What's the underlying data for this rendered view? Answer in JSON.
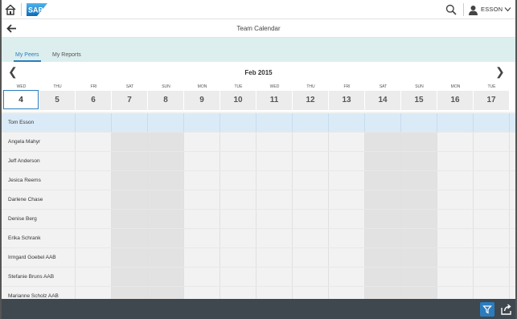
{
  "shell": {
    "brand": "SAP",
    "user_name": "ESSON"
  },
  "page": {
    "title": "Team Calendar"
  },
  "tabs": [
    {
      "label": "My Peers",
      "selected": true
    },
    {
      "label": "My Reports",
      "selected": false
    }
  ],
  "calendar": {
    "month_label": "Feb 2015",
    "days": [
      {
        "dow": "WED",
        "num": "4",
        "weekend": false,
        "today": true
      },
      {
        "dow": "THU",
        "num": "5",
        "weekend": false
      },
      {
        "dow": "FRI",
        "num": "6",
        "weekend": false
      },
      {
        "dow": "SAT",
        "num": "7",
        "weekend": true
      },
      {
        "dow": "SUN",
        "num": "8",
        "weekend": true
      },
      {
        "dow": "MON",
        "num": "9",
        "weekend": false
      },
      {
        "dow": "TUE",
        "num": "10",
        "weekend": false
      },
      {
        "dow": "WED",
        "num": "11",
        "weekend": false
      },
      {
        "dow": "THU",
        "num": "12",
        "weekend": false
      },
      {
        "dow": "FRI",
        "num": "13",
        "weekend": false
      },
      {
        "dow": "SAT",
        "num": "14",
        "weekend": true
      },
      {
        "dow": "SUN",
        "num": "15",
        "weekend": true
      },
      {
        "dow": "MON",
        "num": "16",
        "weekend": false
      },
      {
        "dow": "TUE",
        "num": "17",
        "weekend": false
      }
    ],
    "people": [
      {
        "name": "Tom Esson",
        "selected": true
      },
      {
        "name": "Angela Mahyr"
      },
      {
        "name": "Jeff Anderson"
      },
      {
        "name": "Jesica Reems"
      },
      {
        "name": "Darlene Chase"
      },
      {
        "name": "Denise Berg"
      },
      {
        "name": "Erika Schrank"
      },
      {
        "name": "Irmgard Goebel AAB"
      },
      {
        "name": "Stefanie Bruns AAB"
      },
      {
        "name": "Marianne Scholz AAB"
      }
    ]
  },
  "colors": {
    "accent": "#2b7cbd",
    "tabbar": "#dcefee",
    "footer": "#3f474f",
    "selected_row": "#dbeaf7"
  }
}
